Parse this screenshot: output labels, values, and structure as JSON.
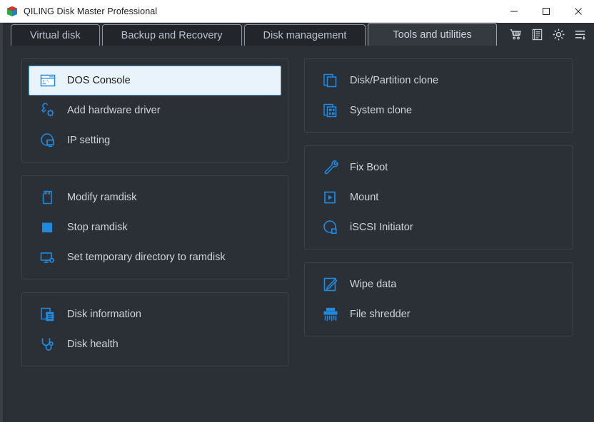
{
  "window": {
    "title": "QILING Disk Master Professional",
    "app_icon": "cube-icon",
    "controls": [
      {
        "name": "minimize-button",
        "icon": "minimize-icon"
      },
      {
        "name": "maximize-button",
        "icon": "maximize-icon"
      },
      {
        "name": "close-button",
        "icon": "close-icon"
      }
    ]
  },
  "tabs": [
    {
      "label": "Virtual disk",
      "active": false
    },
    {
      "label": "Backup and Recovery",
      "active": false
    },
    {
      "label": "Disk management",
      "active": false
    },
    {
      "label": "Tools and utilities",
      "active": true
    }
  ],
  "toolbar": [
    {
      "name": "cart-button",
      "icon": "shopping-cart-icon"
    },
    {
      "name": "log-button",
      "icon": "document-list-icon"
    },
    {
      "name": "settings-button",
      "icon": "gear-icon"
    },
    {
      "name": "menu-button",
      "icon": "menu-list-icon"
    }
  ],
  "colors": {
    "window_bg": "#2b3036",
    "accent": "#1f8ae0",
    "selected_bg": "#e8f3fc",
    "selected_border": "#4a98d8",
    "text": "#cdd4dc",
    "group_border": "#3c4248"
  },
  "left_column": [
    {
      "group": "system-tools-group",
      "items": [
        {
          "label": "DOS Console",
          "icon": "console-window-icon",
          "selected": true
        },
        {
          "label": "Add hardware driver",
          "icon": "wrench-gear-icon",
          "selected": false
        },
        {
          "label": "IP setting",
          "icon": "network-monitor-icon",
          "selected": false
        }
      ]
    },
    {
      "group": "ramdisk-group",
      "items": [
        {
          "label": "Modify ramdisk",
          "icon": "memory-card-icon",
          "selected": false
        },
        {
          "label": "Stop ramdisk",
          "icon": "stop-square-icon",
          "selected": false
        },
        {
          "label": "Set temporary directory to ramdisk",
          "icon": "monitor-gear-icon",
          "selected": false
        }
      ]
    },
    {
      "group": "disk-info-group",
      "items": [
        {
          "label": "Disk information",
          "icon": "documents-icon",
          "selected": false
        },
        {
          "label": "Disk health",
          "icon": "stethoscope-icon",
          "selected": false
        }
      ]
    }
  ],
  "right_column": [
    {
      "group": "clone-group",
      "items": [
        {
          "label": "Disk/Partition clone",
          "icon": "clone-pages-icon",
          "selected": false
        },
        {
          "label": "System clone",
          "icon": "system-clone-icon",
          "selected": false
        }
      ]
    },
    {
      "group": "boot-group",
      "items": [
        {
          "label": "Fix Boot",
          "icon": "wrench-icon",
          "selected": false
        },
        {
          "label": "Mount",
          "icon": "play-square-icon",
          "selected": false
        },
        {
          "label": "iSCSI Initiator",
          "icon": "iscsi-circle-icon",
          "selected": false
        }
      ]
    },
    {
      "group": "wipe-group",
      "items": [
        {
          "label": "Wipe data",
          "icon": "wipe-pencil-icon",
          "selected": false
        },
        {
          "label": "File shredder",
          "icon": "shredder-icon",
          "selected": false
        }
      ]
    }
  ]
}
